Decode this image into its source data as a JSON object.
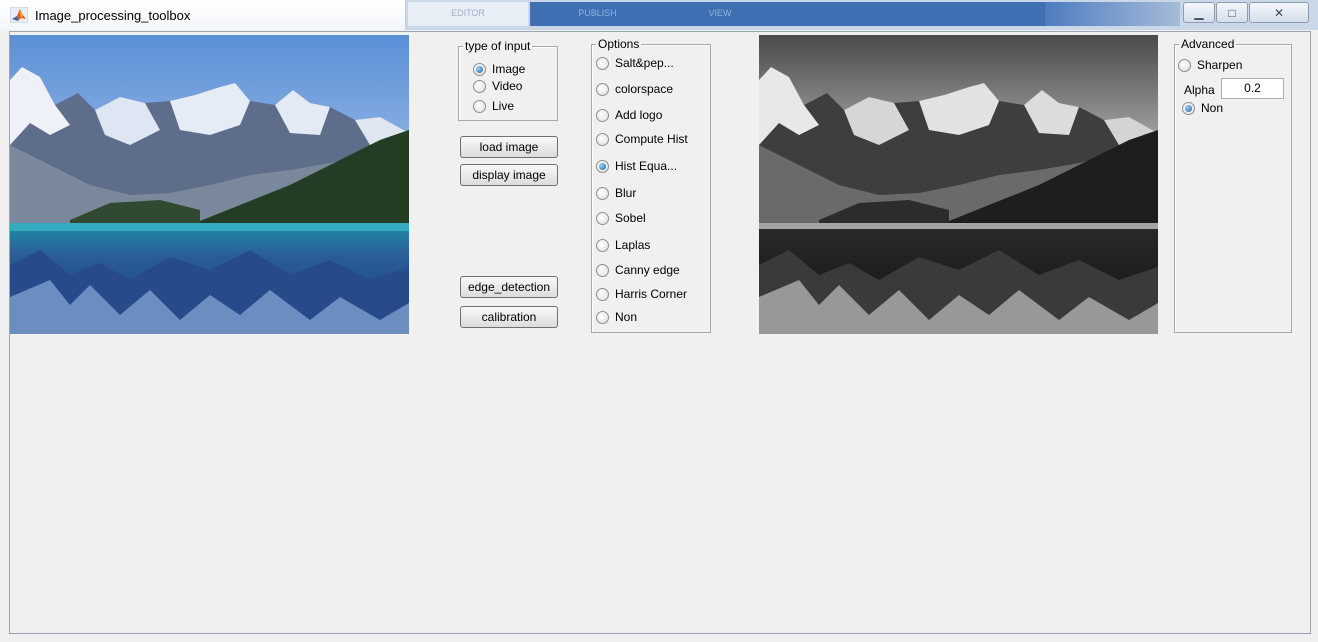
{
  "window": {
    "title": "Image_processing_toolbox",
    "background_tabs": [
      "EDITOR",
      "PUBLISH",
      "VIEW"
    ],
    "controls": {
      "minimize": "▁",
      "maximize": "□",
      "close": "✕"
    }
  },
  "input_type": {
    "title": "type of input",
    "options": [
      {
        "label": "Image",
        "selected": true
      },
      {
        "label": "Video",
        "selected": false
      },
      {
        "label": "Live",
        "selected": false
      }
    ]
  },
  "buttons": {
    "load_image": "load image",
    "display_image": "display image",
    "edge_detection": "edge_detection",
    "calibration": "calibration"
  },
  "options": {
    "title": "Options",
    "items": [
      {
        "label": "Salt&pep...",
        "selected": false
      },
      {
        "label": "colorspace",
        "selected": false
      },
      {
        "label": "Add logo",
        "selected": false
      },
      {
        "label": "Compute Hist",
        "selected": false
      },
      {
        "label": "Hist Equa...",
        "selected": true
      },
      {
        "label": "Blur",
        "selected": false
      },
      {
        "label": "Sobel",
        "selected": false
      },
      {
        "label": "Laplas",
        "selected": false
      },
      {
        "label": "Canny edge",
        "selected": false
      },
      {
        "label": "Harris Corner",
        "selected": false
      },
      {
        "label": "Non",
        "selected": false
      }
    ]
  },
  "advanced": {
    "title": "Advanced",
    "sharpen_label": "Sharpen",
    "sharpen_selected": false,
    "alpha_label": "Alpha",
    "alpha_value": "0.2",
    "non_label": "Non",
    "non_selected": true
  },
  "colors": {
    "accent": "#1a5f9c",
    "titlebar": "#c9d7e8"
  }
}
